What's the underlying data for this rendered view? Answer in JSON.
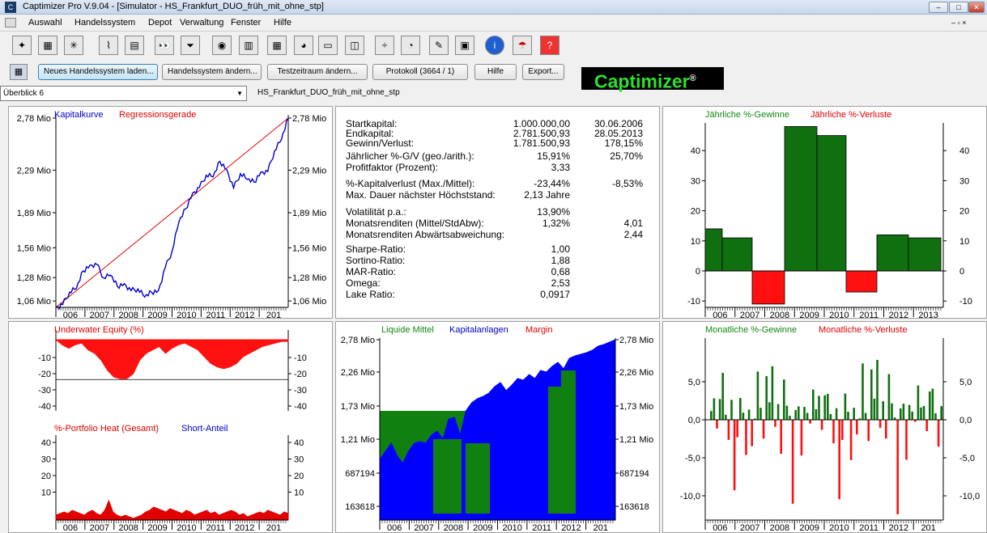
{
  "window": {
    "title": "Captimizer Pro V.9.04 - [Simulator - HS_Frankfurt_DUO_früh_mit_ohne_stp]"
  },
  "menu": [
    "Auswahl",
    "Handelssystem",
    "Depot",
    "Verwaltung",
    "Fenster",
    "Hilfe"
  ],
  "toolbar_icons": [
    "compass-icon",
    "cubes-icon",
    "star-chart-icon",
    "line-chart-icon",
    "chart-icon",
    "eyes-icon",
    "funnel-icon",
    "depot-icon",
    "table-icon",
    "grid-icon",
    "pie-icon",
    "card-icon",
    "book-icon",
    "gv-icon",
    "dial-icon",
    "pen-icon",
    "cube-icon",
    "info-icon",
    "help-person-icon",
    "question-icon"
  ],
  "logo": {
    "text": "Captimizer",
    "mark": "®"
  },
  "buttons": {
    "neu": "Neues Handelssystem laden...",
    "aendern": "Handelssystem ändern...",
    "test": "Testzeitraum ändern...",
    "protokoll": "Protokoll (3664 / 1)",
    "hilfe": "Hilfe",
    "export": "Export..."
  },
  "selector": {
    "value": "Überblick 6",
    "system": "HS_Frankfurt_DUO_früh_mit_ohne_stp"
  },
  "years": [
    "006",
    "2007",
    "2008",
    "2009",
    "2010",
    "2011",
    "2012",
    "201"
  ],
  "years_b": [
    "006",
    "2007",
    "2008",
    "2009",
    "2010",
    "2011",
    "2012",
    "2013"
  ],
  "p1": {
    "t1": "Kapitalkurve",
    "t2": "Regressionsgerade",
    "ticks": [
      "2,78 Mio",
      "2,29 Mio",
      "1,89 Mio",
      "1,56 Mio",
      "1,28 Mio",
      "1,06 Mio"
    ],
    "colors": {
      "line": "#0000cc",
      "reg": "#e00000"
    }
  },
  "stats": [
    {
      "l": "Startkapital:",
      "v1": "1.000.000,00",
      "v2": "30.06.2006"
    },
    {
      "l": "Endkapital:",
      "v1": "2.781.500,93",
      "v2": "28.05.2013"
    },
    {
      "l": "Gewinn/Verlust:",
      "v1": "1.781.500,93",
      "v2": "178,15%"
    },
    {
      "l": "Jährlicher %-G/V (geo./arith.):",
      "v1": "15,91%",
      "v2": "25,70%"
    },
    {
      "l": "Profitfaktor (Prozent):",
      "v1": "3,33",
      "v2": ""
    },
    {
      "l": "%-Kapitalverlust (Max./Mittel):",
      "v1": "-23,44%",
      "v2": "-8,53%"
    },
    {
      "l": "Max. Dauer nächster Höchststand:",
      "v1": "2,13 Jahre",
      "v2": ""
    },
    {
      "l": "Volatilität p.a.:",
      "v1": "13,90%",
      "v2": ""
    },
    {
      "l": "Monatsrenditen (Mittel/StdAbw):",
      "v1": "1,32%",
      "v2": "4,01"
    },
    {
      "l": "Monatsrenditen Abwärtsabweichung:",
      "v1": "",
      "v2": "2,44"
    },
    {
      "l": "Sharpe-Ratio:",
      "v1": "1,00",
      "v2": ""
    },
    {
      "l": "Sortino-Ratio:",
      "v1": "1,88",
      "v2": ""
    },
    {
      "l": "MAR-Ratio:",
      "v1": "0,68",
      "v2": ""
    },
    {
      "l": "Omega:",
      "v1": "2,53",
      "v2": ""
    },
    {
      "l": "Lake Ratio:",
      "v1": "0,0917",
      "v2": ""
    }
  ],
  "p3": {
    "t1": "Jährliche %-Gewinne",
    "t2": "Jährliche %-Verluste",
    "ticks": [
      "40",
      "30",
      "20",
      "10",
      "0",
      "-10"
    ]
  },
  "p4": {
    "t1": "Underwater Equity (%)",
    "ticks": [
      "-10",
      "-20",
      "-30",
      "-40"
    ],
    "t2": "%-Portfolio Heat (Gesamt)",
    "t3": "Short-Anteil",
    "ticks2": [
      "40",
      "30",
      "20",
      "10"
    ]
  },
  "p5": {
    "t1": "Liquide Mittel",
    "t2": "Kapitalanlagen",
    "t3": "Margin",
    "ticks": [
      "2,78 Mio",
      "2,26 Mio",
      "1,73 Mio",
      "1,21 Mio",
      "687194",
      "163618"
    ]
  },
  "p6": {
    "t1": "Monatliche %-Gewinne",
    "t2": "Monatliche %-Verluste",
    "ticks": [
      "5,0",
      "0,0",
      "-5,0",
      "-10,0"
    ]
  },
  "chart_data": [
    {
      "type": "line",
      "title": "Kapitalkurve",
      "series": [
        {
          "name": "Kapitalkurve",
          "values": [
            1.0,
            1.05,
            1.12,
            1.2,
            1.32,
            1.42,
            1.38,
            1.3,
            1.28,
            1.22,
            1.2,
            1.18,
            1.15,
            1.12,
            1.12,
            1.18,
            1.35,
            1.55,
            1.78,
            1.95,
            2.05,
            2.15,
            2.22,
            2.25,
            2.35,
            2.32,
            2.1,
            2.28,
            2.18,
            2.2,
            2.25,
            2.3,
            2.45,
            2.6,
            2.78
          ]
        },
        {
          "name": "Regressionsgerade",
          "values": [
            1.0,
            2.78
          ]
        }
      ],
      "ylim": [
        1.0,
        2.78
      ],
      "x": [
        "2006",
        "2007",
        "2008",
        "2009",
        "2010",
        "2011",
        "2012",
        "2013"
      ]
    },
    {
      "type": "bar",
      "title": "Jährliche %-Gewinne / Jährliche %-Verluste",
      "categories": [
        "2006",
        "2007",
        "2008",
        "2009",
        "2010",
        "2011",
        "2012",
        "2013"
      ],
      "values": [
        14,
        11,
        -11,
        48,
        45,
        -7,
        12,
        11
      ],
      "ylim": [
        -12,
        48
      ]
    },
    {
      "type": "area",
      "title": "Underwater Equity (%)",
      "x": [
        "2006",
        "2007",
        "2008",
        "2009",
        "2010",
        "2011",
        "2012",
        "2013"
      ],
      "min": -23.44,
      "ylim": [
        -45,
        0
      ]
    },
    {
      "type": "area",
      "title": "Liquide Mittel / Kapitalanlagen / Margin",
      "ylim": [
        163618,
        2780000
      ],
      "series": [
        {
          "name": "Kapitalanlagen",
          "values": [
            0.25,
            0.45,
            0.55,
            0.4,
            0.3,
            0.55,
            0.65,
            0.7,
            0.75,
            0.8,
            0.85,
            0.78,
            0.85,
            0.9,
            0.95,
            1.0
          ]
        }
      ]
    },
    {
      "type": "bar",
      "title": "Monatliche %-Gewinne / Monatliche %-Verluste",
      "values": [
        2.1,
        3.0,
        -1.5,
        4.5,
        6.2,
        0.8,
        -4.0,
        2.5,
        -10.5,
        -3.2,
        5.2,
        1.0,
        -6.0,
        2.2,
        -3.5,
        0.2,
        9.6,
        1.5,
        -2.8,
        8.0,
        4.2,
        7.5,
        -1.2,
        3.4,
        -4.5,
        6.4,
        2.8,
        0.5,
        -12.5,
        1.8,
        3.2,
        -5.0,
        2.2,
        1.5,
        -0.5,
        4.8
      ],
      "ylim": [
        -13,
        10
      ]
    }
  ]
}
